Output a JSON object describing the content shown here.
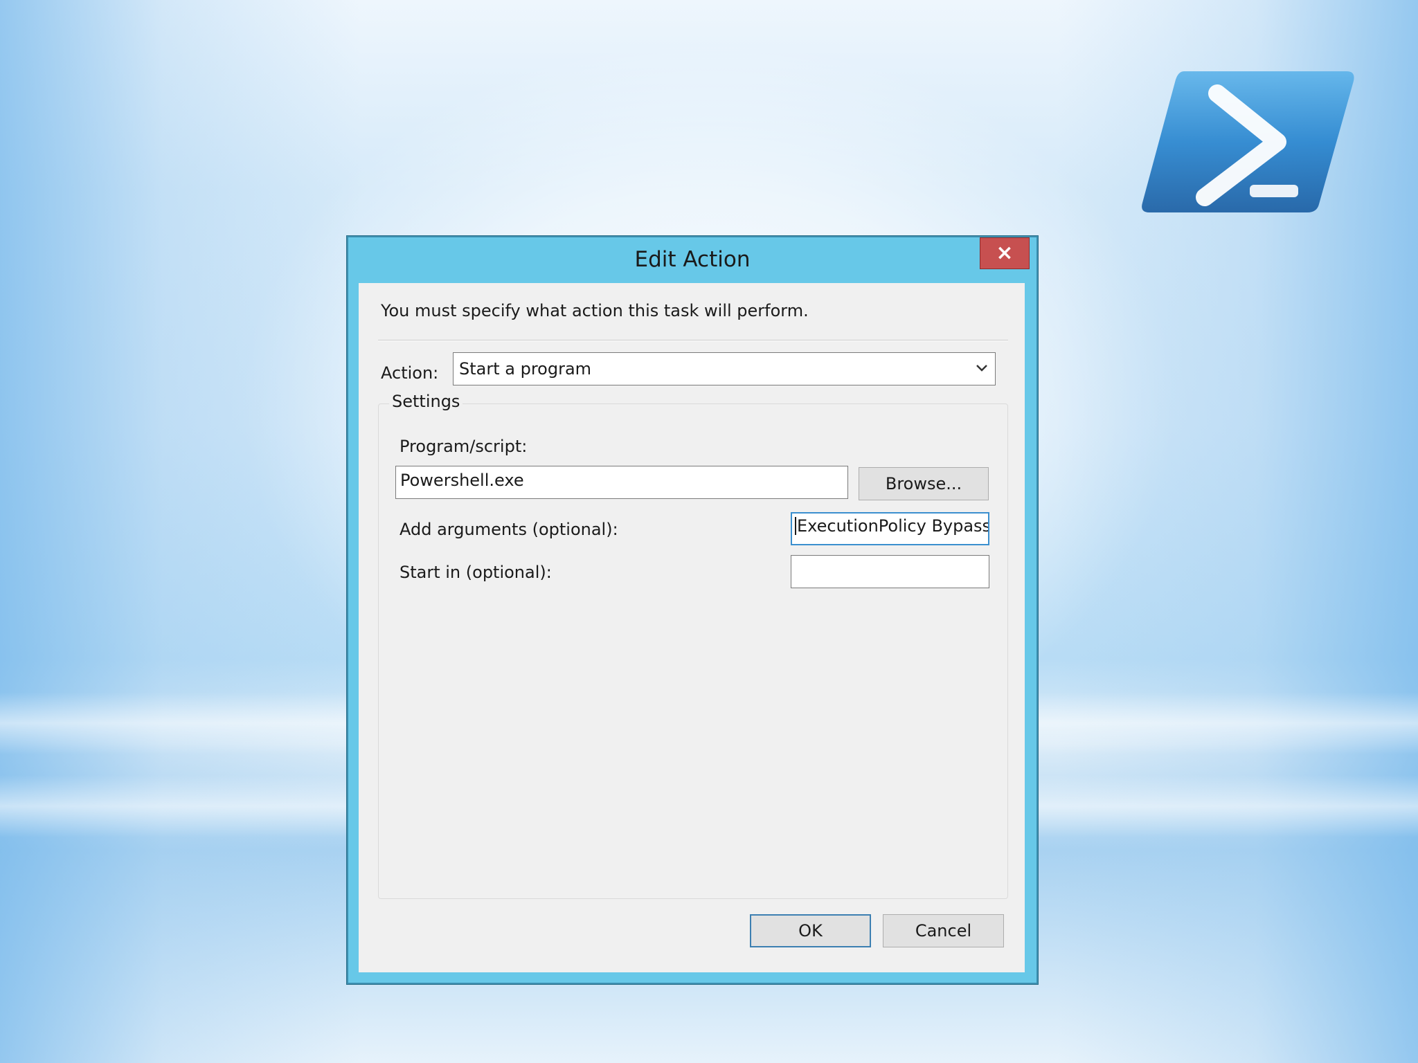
{
  "dialog": {
    "title": "Edit Action",
    "close_label": "×",
    "intro_text": "You must specify what action this task will perform.",
    "action_label": "Action:",
    "action_value": "Start a program",
    "settings_label": "Settings",
    "program_label": "Program/script:",
    "program_value": "Powershell.exe",
    "browse_label": "Browse...",
    "arguments_label": "Add arguments (optional):",
    "arguments_value": "ExecutionPolicy Bypass",
    "start_in_label": "Start in (optional):",
    "start_in_value": "",
    "ok_label": "OK",
    "cancel_label": "Cancel"
  },
  "colors": {
    "titlebar": "#67c8e8",
    "close_button": "#c75050",
    "client": "#f0f0f0",
    "focus_border": "#3a8fcf"
  },
  "icons": {
    "logo": "powershell-logo",
    "close": "close-icon",
    "dropdown": "chevron-down-icon"
  }
}
